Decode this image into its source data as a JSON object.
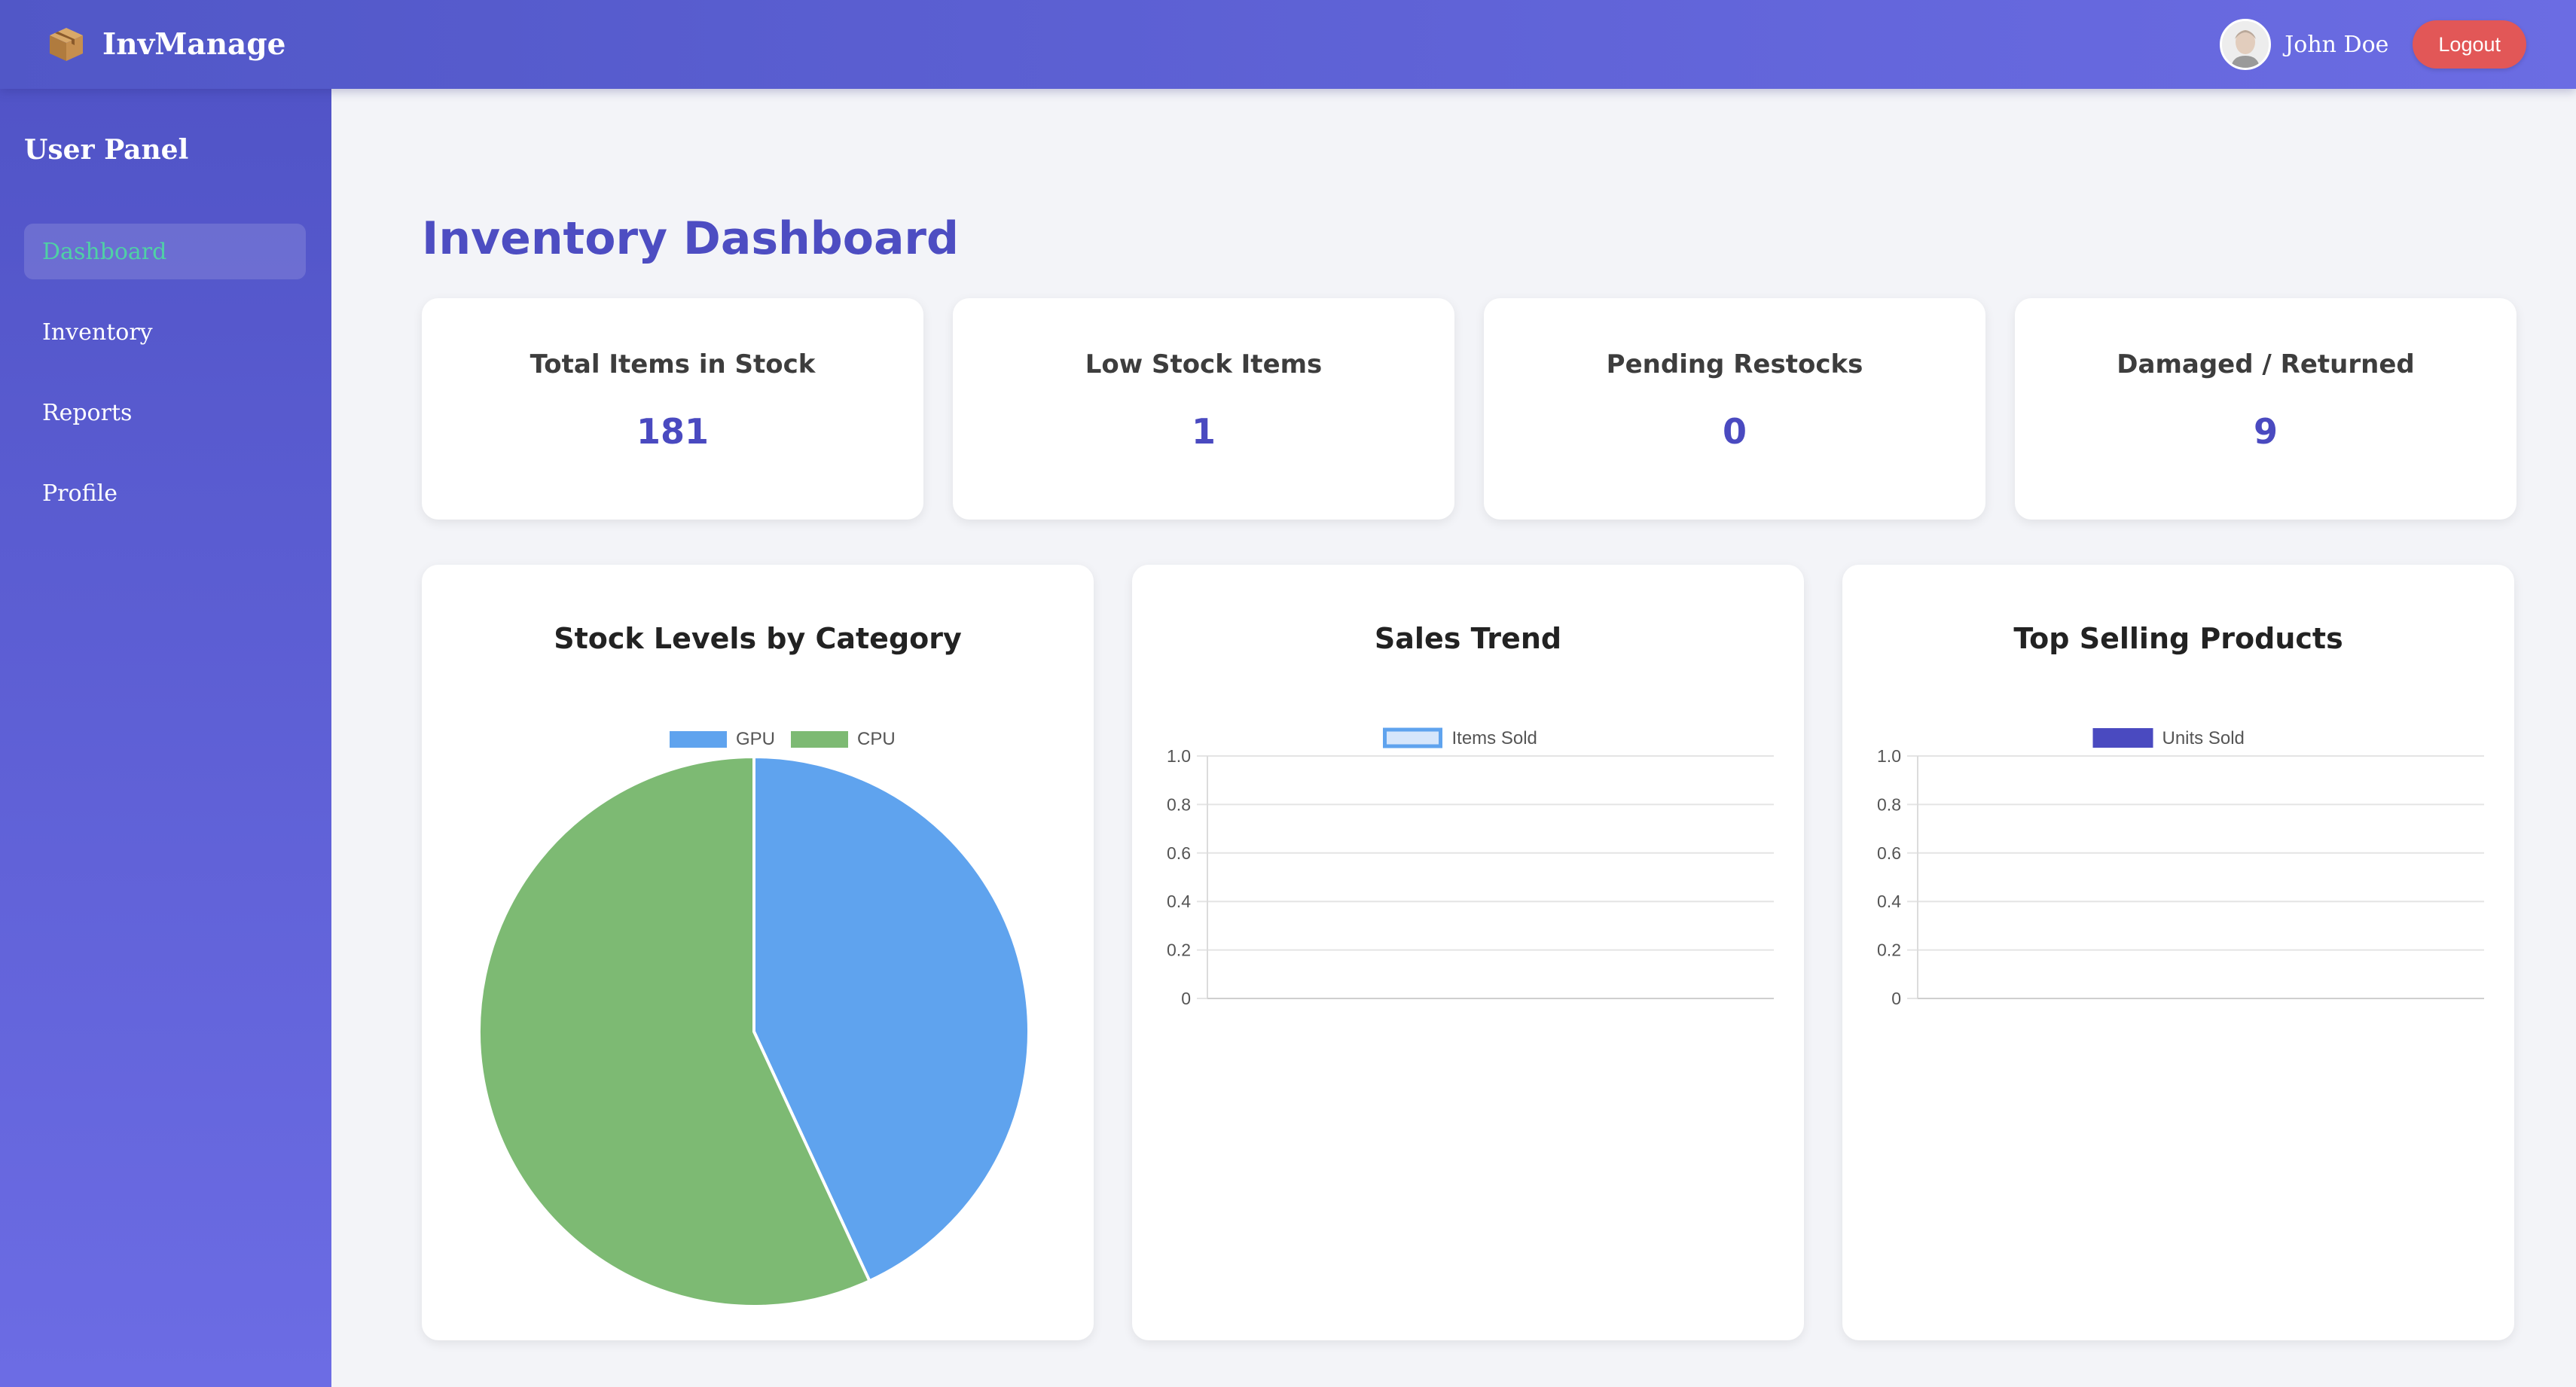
{
  "app": {
    "brand": "InvManage",
    "brand_icon": "package-box-icon"
  },
  "header": {
    "user_name": "John Doe",
    "logout_label": "Logout"
  },
  "sidebar": {
    "title": "User Panel",
    "items": [
      {
        "label": "Dashboard",
        "active": true
      },
      {
        "label": "Inventory",
        "active": false
      },
      {
        "label": "Reports",
        "active": false
      },
      {
        "label": "Profile",
        "active": false
      }
    ]
  },
  "main": {
    "title": "Inventory Dashboard",
    "stats": [
      {
        "label": "Total Items in Stock",
        "value": "181"
      },
      {
        "label": "Low Stock Items",
        "value": "1"
      },
      {
        "label": "Pending Restocks",
        "value": "0"
      },
      {
        "label": "Damaged / Returned",
        "value": "9"
      }
    ]
  },
  "colors": {
    "accent": "#4d4dc2",
    "active_nav_text": "#4fd1a5",
    "logout": "#e25757",
    "gpu": "#5fa3ee",
    "cpu": "#7dba73",
    "units_sold": "#4a4ac0",
    "items_sold_border": "#5fa3ee"
  },
  "chart_data": [
    {
      "type": "pie",
      "title": "Stock Levels by Category",
      "legend_position": "top",
      "labels": [
        "GPU",
        "CPU"
      ],
      "values": [
        78,
        103
      ],
      "colors": [
        "#5fa3ee",
        "#7dba73"
      ]
    },
    {
      "type": "line",
      "title": "Sales Trend",
      "legend_position": "top",
      "series": [
        {
          "name": "Items Sold",
          "values": []
        }
      ],
      "ylim": [
        0,
        1
      ],
      "yticks": [
        "0",
        "0.2",
        "0.4",
        "0.6",
        "0.8",
        "1.0"
      ],
      "grid": true
    },
    {
      "type": "bar",
      "title": "Top Selling Products",
      "legend_position": "top",
      "series": [
        {
          "name": "Units Sold",
          "values": []
        }
      ],
      "ylim": [
        0,
        1
      ],
      "yticks": [
        "0",
        "0.2",
        "0.4",
        "0.6",
        "0.8",
        "1.0"
      ],
      "grid": true
    }
  ]
}
